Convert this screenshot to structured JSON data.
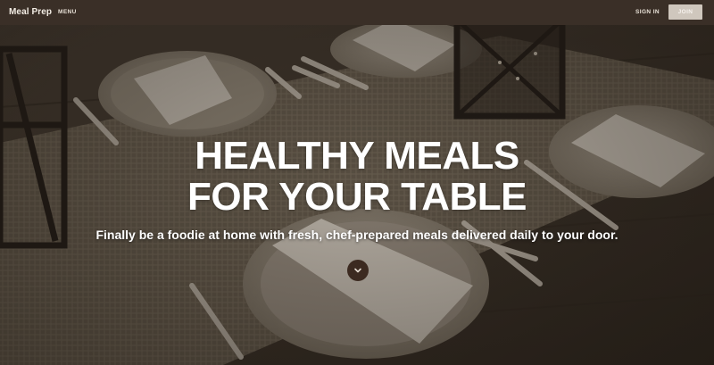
{
  "header": {
    "brand": "Meal Prep",
    "menu_label": "MENU",
    "signin_label": "SIGN IN",
    "join_label": "JOIN"
  },
  "hero": {
    "headline_line1": "HEALTHY MEALS",
    "headline_line2": "FOR YOUR TABLE",
    "subheading": "Finally be a foodie at home with fresh, chef-prepared meals delivered daily to your door.",
    "scroll_icon": "chevron-down-icon",
    "background_image": "sepia-toned photo of a dining table with plates, napkins, forks, knives and lanterns on a burlap runner"
  },
  "colors": {
    "topbar": "#3a2f27",
    "join_button": "#cfc7bd",
    "scroll_button": "#3c2a20",
    "text": "#ffffff"
  }
}
